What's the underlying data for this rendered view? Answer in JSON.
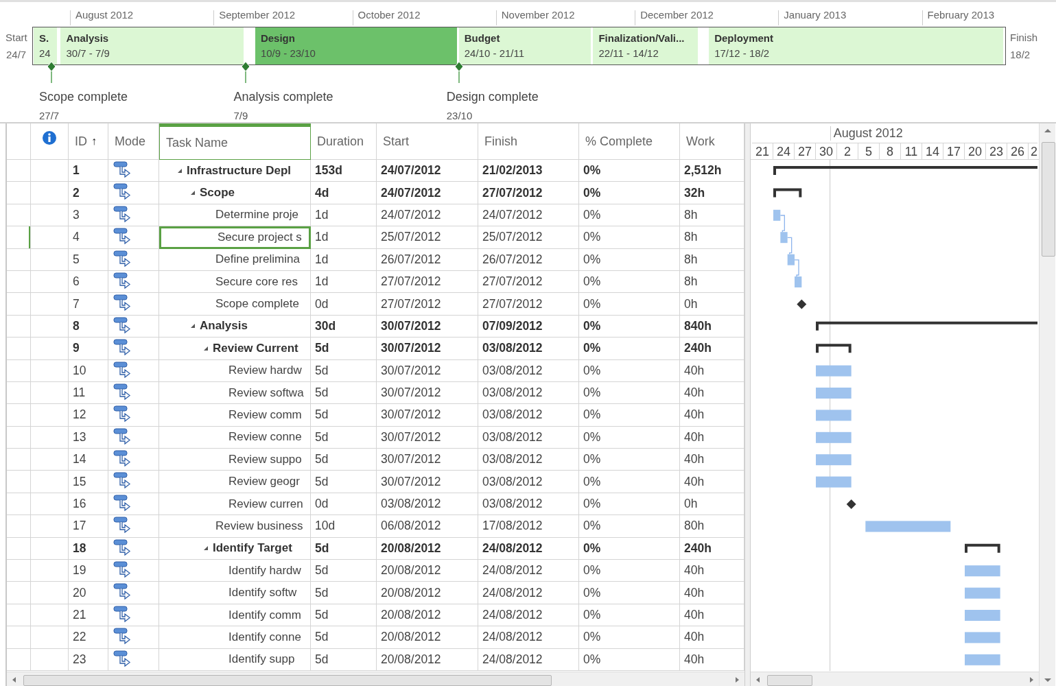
{
  "timeline": {
    "start": {
      "label": "Start",
      "date": "24/7"
    },
    "finish": {
      "label": "Finish",
      "date": "18/2"
    },
    "months": [
      "August 2012",
      "September 2012",
      "October 2012",
      "November 2012",
      "December 2012",
      "January 2013",
      "February 2013"
    ],
    "phases": [
      {
        "name": "S.",
        "dates": "24",
        "selected": false
      },
      {
        "name": "Analysis",
        "dates": "30/7 - 7/9",
        "selected": false
      },
      {
        "name": "Design",
        "dates": "10/9 - 23/10",
        "selected": true
      },
      {
        "name": "Budget",
        "dates": "24/10 - 21/11",
        "selected": false
      },
      {
        "name": "Finalization/Vali...",
        "dates": "22/11 - 14/12",
        "selected": false
      },
      {
        "name": "Deployment",
        "dates": "17/12 - 18/2",
        "selected": false
      }
    ],
    "milestones": [
      {
        "name": "Scope complete",
        "date": "27/7"
      },
      {
        "name": "Analysis complete",
        "date": "7/9"
      },
      {
        "name": "Design complete",
        "date": "23/10"
      }
    ]
  },
  "table": {
    "columns": [
      {
        "label": "ID",
        "sort_indicator": "↑",
        "selected": false
      },
      {
        "label": "Mode",
        "selected": false
      },
      {
        "label": "Task Name",
        "selected": true
      },
      {
        "label": "Duration",
        "selected": false
      },
      {
        "label": "Start",
        "selected": false
      },
      {
        "label": "Finish",
        "selected": false
      },
      {
        "label": "% Complete",
        "selected": false
      },
      {
        "label": "Work",
        "selected": false
      }
    ],
    "rows": [
      {
        "id": "1",
        "name": "Infrastructure Depl",
        "duration": "153d",
        "start": "24/07/2012",
        "finish": "21/02/2013",
        "complete": "0%",
        "work": "2,512h",
        "kind": "summary",
        "expanded": true,
        "selected": false,
        "children": [
          {
            "id": "2",
            "name": "Scope",
            "duration": "4d",
            "start": "24/07/2012",
            "finish": "27/07/2012",
            "complete": "0%",
            "work": "32h",
            "kind": "summary",
            "expanded": true,
            "selected": false,
            "children": [
              {
                "id": "3",
                "name": "Determine proje",
                "duration": "1d",
                "start": "24/07/2012",
                "finish": "24/07/2012",
                "complete": "0%",
                "work": "8h",
                "kind": "task",
                "selected": false
              },
              {
                "id": "4",
                "name": "Secure project s",
                "duration": "1d",
                "start": "25/07/2012",
                "finish": "25/07/2012",
                "complete": "0%",
                "work": "8h",
                "kind": "task",
                "selected": true
              },
              {
                "id": "5",
                "name": "Define prelimina",
                "duration": "1d",
                "start": "26/07/2012",
                "finish": "26/07/2012",
                "complete": "0%",
                "work": "8h",
                "kind": "task",
                "selected": false
              },
              {
                "id": "6",
                "name": "Secure core res",
                "duration": "1d",
                "start": "27/07/2012",
                "finish": "27/07/2012",
                "complete": "0%",
                "work": "8h",
                "kind": "task",
                "selected": false
              },
              {
                "id": "7",
                "name": "Scope complete",
                "duration": "0d",
                "start": "27/07/2012",
                "finish": "27/07/2012",
                "complete": "0%",
                "work": "0h",
                "kind": "milestone",
                "selected": false
              }
            ]
          },
          {
            "id": "8",
            "name": "Analysis",
            "duration": "30d",
            "start": "30/07/2012",
            "finish": "07/09/2012",
            "complete": "0%",
            "work": "840h",
            "kind": "summary",
            "expanded": true,
            "selected": false,
            "children": [
              {
                "id": "9",
                "name": "Review Current",
                "duration": "5d",
                "start": "30/07/2012",
                "finish": "03/08/2012",
                "complete": "0%",
                "work": "240h",
                "kind": "summary",
                "expanded": true,
                "selected": false,
                "children": [
                  {
                    "id": "10",
                    "name": "Review hardw",
                    "duration": "5d",
                    "start": "30/07/2012",
                    "finish": "03/08/2012",
                    "complete": "0%",
                    "work": "40h",
                    "kind": "task",
                    "selected": false
                  },
                  {
                    "id": "11",
                    "name": "Review softwa",
                    "duration": "5d",
                    "start": "30/07/2012",
                    "finish": "03/08/2012",
                    "complete": "0%",
                    "work": "40h",
                    "kind": "task",
                    "selected": false
                  },
                  {
                    "id": "12",
                    "name": "Review comm",
                    "duration": "5d",
                    "start": "30/07/2012",
                    "finish": "03/08/2012",
                    "complete": "0%",
                    "work": "40h",
                    "kind": "task",
                    "selected": false
                  },
                  {
                    "id": "13",
                    "name": "Review conne",
                    "duration": "5d",
                    "start": "30/07/2012",
                    "finish": "03/08/2012",
                    "complete": "0%",
                    "work": "40h",
                    "kind": "task",
                    "selected": false
                  },
                  {
                    "id": "14",
                    "name": "Review suppo",
                    "duration": "5d",
                    "start": "30/07/2012",
                    "finish": "03/08/2012",
                    "complete": "0%",
                    "work": "40h",
                    "kind": "task",
                    "selected": false
                  },
                  {
                    "id": "15",
                    "name": "Review geogr",
                    "duration": "5d",
                    "start": "30/07/2012",
                    "finish": "03/08/2012",
                    "complete": "0%",
                    "work": "40h",
                    "kind": "task",
                    "selected": false
                  },
                  {
                    "id": "16",
                    "name": "Review curren",
                    "duration": "0d",
                    "start": "03/08/2012",
                    "finish": "03/08/2012",
                    "complete": "0%",
                    "work": "0h",
                    "kind": "milestone",
                    "selected": false
                  }
                ]
              },
              {
                "id": "17",
                "name": "Review business",
                "duration": "10d",
                "start": "06/08/2012",
                "finish": "17/08/2012",
                "complete": "0%",
                "work": "80h",
                "kind": "task",
                "selected": false
              },
              {
                "id": "18",
                "name": "Identify Target",
                "duration": "5d",
                "start": "20/08/2012",
                "finish": "24/08/2012",
                "complete": "0%",
                "work": "240h",
                "kind": "summary",
                "expanded": true,
                "selected": false,
                "children": [
                  {
                    "id": "19",
                    "name": "Identify hardw",
                    "duration": "5d",
                    "start": "20/08/2012",
                    "finish": "24/08/2012",
                    "complete": "0%",
                    "work": "40h",
                    "kind": "task",
                    "selected": false
                  },
                  {
                    "id": "20",
                    "name": "Identify softw",
                    "duration": "5d",
                    "start": "20/08/2012",
                    "finish": "24/08/2012",
                    "complete": "0%",
                    "work": "40h",
                    "kind": "task",
                    "selected": false
                  },
                  {
                    "id": "21",
                    "name": "Identify comm",
                    "duration": "5d",
                    "start": "20/08/2012",
                    "finish": "24/08/2012",
                    "complete": "0%",
                    "work": "40h",
                    "kind": "task",
                    "selected": false
                  },
                  {
                    "id": "22",
                    "name": "Identify conne",
                    "duration": "5d",
                    "start": "20/08/2012",
                    "finish": "24/08/2012",
                    "complete": "0%",
                    "work": "40h",
                    "kind": "task",
                    "selected": false
                  },
                  {
                    "id": "23",
                    "name": "Identify supp",
                    "duration": "5d",
                    "start": "20/08/2012",
                    "finish": "24/08/2012",
                    "complete": "0%",
                    "work": "40h",
                    "kind": "task",
                    "selected": false
                  }
                ]
              }
            ]
          }
        ]
      }
    ]
  },
  "gantt": {
    "month": "August 2012",
    "days": [
      "21",
      "24",
      "27",
      "30",
      "2",
      "5",
      "8",
      "11",
      "14",
      "17",
      "20",
      "23",
      "26",
      "2"
    ]
  }
}
